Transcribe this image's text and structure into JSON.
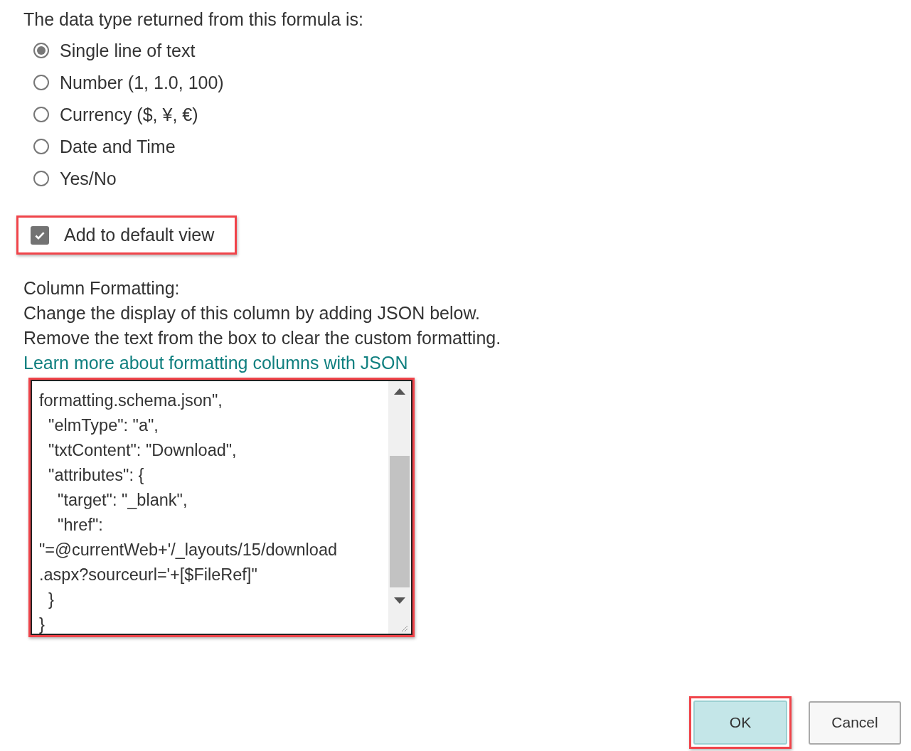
{
  "return_type": {
    "label": "The data type returned from this formula is:",
    "options": [
      {
        "label": "Single line of text",
        "selected": true
      },
      {
        "label": "Number (1, 1.0, 100)",
        "selected": false
      },
      {
        "label": "Currency ($, ¥, €)",
        "selected": false
      },
      {
        "label": "Date and Time",
        "selected": false
      },
      {
        "label": "Yes/No",
        "selected": false
      }
    ]
  },
  "default_view": {
    "label": "Add to default view",
    "checked": true,
    "highlighted": true
  },
  "column_formatting": {
    "heading": "Column Formatting:",
    "description": [
      "Change the display of this column by adding JSON below.",
      "Remove the text from the box to clear the custom formatting."
    ],
    "link": "Learn more about formatting columns with JSON",
    "editor": {
      "highlighted": true,
      "lines": [
        "formatting.schema.json\",",
        "  \"elmType\": \"a\",",
        "  \"txtContent\": \"Download\",",
        "  \"attributes\": {",
        "    \"target\": \"_blank\",",
        "    \"href\": ",
        "\"=@currentWeb+'/_layouts/15/download",
        ".aspx?sourceurl='+[$FileRef]\"",
        "  }",
        "}"
      ]
    }
  },
  "buttons": [
    {
      "label": "OK",
      "kind": "primary",
      "highlighted": true
    },
    {
      "label": "Cancel",
      "kind": "default",
      "highlighted": false
    }
  ]
}
